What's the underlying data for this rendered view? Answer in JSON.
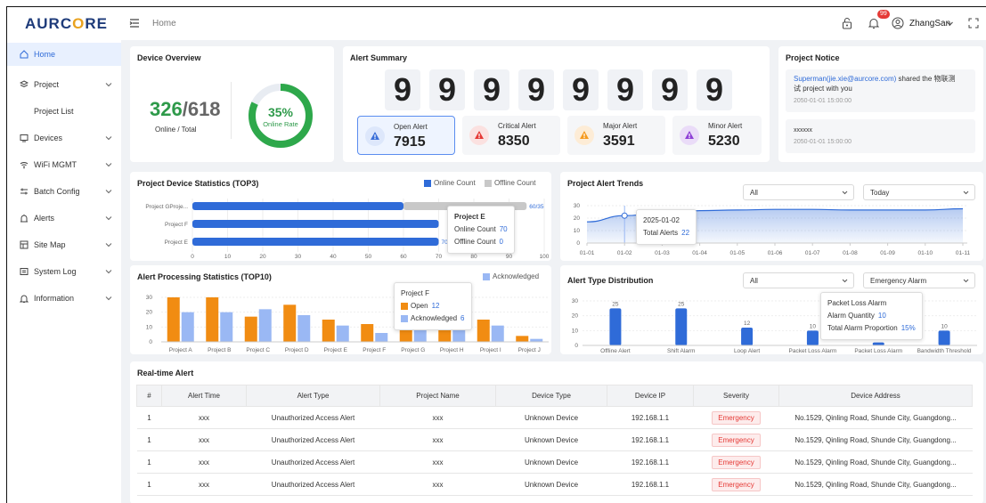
{
  "header": {
    "logo_prefix": "AURC",
    "logo_o": "O",
    "logo_suffix": "RE",
    "breadcrumb": "Home",
    "notification_count": "99",
    "user_name": "ZhangSan"
  },
  "sidebar": {
    "items": [
      {
        "label": "Home",
        "icon": "home-icon",
        "active": true
      },
      {
        "label": "Project",
        "icon": "layers-icon"
      },
      {
        "label": "Project List",
        "sub": true
      },
      {
        "label": "Devices",
        "icon": "monitor-icon"
      },
      {
        "label": "WiFi MGMT",
        "icon": "wifi-icon"
      },
      {
        "label": "Batch Config",
        "icon": "sliders-icon"
      },
      {
        "label": "Alerts",
        "icon": "alert-icon"
      },
      {
        "label": "Site Map",
        "icon": "map-icon"
      },
      {
        "label": "System Log",
        "icon": "log-icon"
      },
      {
        "label": "Information",
        "icon": "bell-icon"
      }
    ]
  },
  "device_overview": {
    "title": "Device Overview",
    "online": "326",
    "total": "/618",
    "caption": "Online / Total",
    "rate": "35%",
    "rate_label": "Online Rate",
    "rate_fraction": 0.82
  },
  "alert_summary": {
    "title": "Alert Summary",
    "digits": [
      "9",
      "9",
      "9",
      "9",
      "9",
      "9",
      "9",
      "9"
    ],
    "boxes": [
      {
        "label": "Open Alert",
        "value": "7915",
        "color": "#3b6fd8"
      },
      {
        "label": "Critical Alert",
        "value": "8350",
        "color": "#e53935"
      },
      {
        "label": "Major Alert",
        "value": "3591",
        "color": "#f59a1e"
      },
      {
        "label": "Minor Alert",
        "value": "5230",
        "color": "#8e3fd6"
      }
    ]
  },
  "project_notice": {
    "title": "Project Notice",
    "notices": [
      {
        "link": "Superman(jie.xie@aurcore.com)",
        "text1": " shared the 物联测",
        "text2": "试 project with you",
        "time": "2050-01-01 15:00:00"
      },
      {
        "text1": "xxxxxx",
        "time": "2050-01-01 15:00:00"
      }
    ]
  },
  "colors": {
    "primary": "#2f6bd8",
    "orange": "#f18c12",
    "light_blue": "#9ab8f4",
    "gray": "#c8c8c8",
    "danger": "#e53935"
  },
  "chart_data": [
    {
      "type": "bar",
      "title": "Project Device Statistics (TOP3)",
      "orientation": "horizontal",
      "categories": [
        "Project GProje...",
        "Project F",
        "Project E"
      ],
      "series": [
        {
          "name": "Online Count",
          "values": [
            60,
            70,
            70
          ]
        },
        {
          "name": "Offline Count",
          "values": [
            35,
            0,
            0
          ]
        }
      ],
      "bar_labels": [
        "60/35",
        "",
        "70"
      ],
      "xlim": [
        0,
        100
      ],
      "xticks": [
        "0",
        "10",
        "20",
        "30",
        "40",
        "50",
        "60",
        "70",
        "80",
        "90",
        "100"
      ],
      "tooltip": {
        "title": "Project E",
        "rows": [
          {
            "label": "Online Count",
            "value": "70"
          },
          {
            "label": "Offline Count",
            "value": "0"
          }
        ]
      }
    },
    {
      "type": "area",
      "title": "Project Alert Trends",
      "x": [
        "01-01",
        "01-02",
        "01-03",
        "01-04",
        "01-05",
        "01-06",
        "01-07",
        "01-08",
        "01-09",
        "01-10",
        "01-11"
      ],
      "series": [
        {
          "name": "Total Alerts",
          "values": [
            17,
            22,
            24,
            26,
            26.5,
            27,
            27,
            26.5,
            26.5,
            26.5,
            27.5
          ]
        }
      ],
      "ylim": [
        0,
        30
      ],
      "yticks": [
        "0",
        "10",
        "20",
        "30"
      ],
      "filters": [
        "All",
        "Today"
      ],
      "tooltip": {
        "title": "2025-01-02",
        "label": "Total Alerts",
        "value": "22"
      }
    },
    {
      "type": "bar",
      "title": "Alert Processing Statistics (TOP10)",
      "categories": [
        "Project A",
        "Project B",
        "Project C",
        "Project D",
        "Project E",
        "Project F",
        "Project G",
        "Project H",
        "Project I",
        "Project J"
      ],
      "series": [
        {
          "name": "Open",
          "values": [
            30,
            30,
            17,
            25,
            15,
            12,
            15,
            13,
            15,
            4
          ]
        },
        {
          "name": "Acknowledged",
          "values": [
            20,
            20,
            22,
            18,
            11,
            6,
            11,
            13,
            11,
            2
          ]
        }
      ],
      "ylim": [
        0,
        30
      ],
      "yticks": [
        "0",
        "10",
        "20",
        "30"
      ],
      "legend": "Acknowledged",
      "tooltip": {
        "title": "Project F",
        "rows": [
          {
            "label": "Open",
            "value": "12"
          },
          {
            "label": "Acknowledged",
            "value": "6"
          }
        ]
      }
    },
    {
      "type": "bar",
      "title": "Alert Type Distribution",
      "categories": [
        "Offline Alert",
        "Shift Alarm",
        "Loop Alert",
        "Packet Loss Alarm",
        "Packet Loss Alarm",
        "Bandwidth Threshold"
      ],
      "values": [
        25,
        25,
        12,
        10,
        2,
        10
      ],
      "bar_labels": [
        "25",
        "25",
        "12",
        "10",
        "",
        "10"
      ],
      "ylim": [
        0,
        30
      ],
      "yticks": [
        "0",
        "10",
        "20",
        "30"
      ],
      "filters": [
        "All",
        "Emergency Alarm"
      ],
      "tooltip": {
        "title": "Packet Loss Alarm",
        "rows": [
          {
            "label": "Alarm Quantity",
            "value": "10"
          },
          {
            "label": "Total Alarm Proportion",
            "value": "15%"
          }
        ]
      }
    }
  ],
  "realtime": {
    "title": "Real-time Alert",
    "columns": [
      "#",
      "Alert Time",
      "Alert Type",
      "Project Name",
      "Device Type",
      "Device IP",
      "Severity",
      "Device Address"
    ],
    "rows": [
      [
        "1",
        "xxx",
        "Unauthorized Access Alert",
        "xxx",
        "Unknown Device",
        "192.168.1.1",
        "Emergency",
        "No.1529, Qinling Road, Shunde City, Guangdong..."
      ],
      [
        "1",
        "xxx",
        "Unauthorized Access Alert",
        "xxx",
        "Unknown Device",
        "192.168.1.1",
        "Emergency",
        "No.1529, Qinling Road, Shunde City, Guangdong..."
      ],
      [
        "1",
        "xxx",
        "Unauthorized Access Alert",
        "xxx",
        "Unknown Device",
        "192.168.1.1",
        "Emergency",
        "No.1529, Qinling Road, Shunde City, Guangdong..."
      ],
      [
        "1",
        "xxx",
        "Unauthorized Access Alert",
        "xxx",
        "Unknown Device",
        "192.168.1.1",
        "Emergency",
        "No.1529, Qinling Road, Shunde City, Guangdong..."
      ]
    ]
  }
}
